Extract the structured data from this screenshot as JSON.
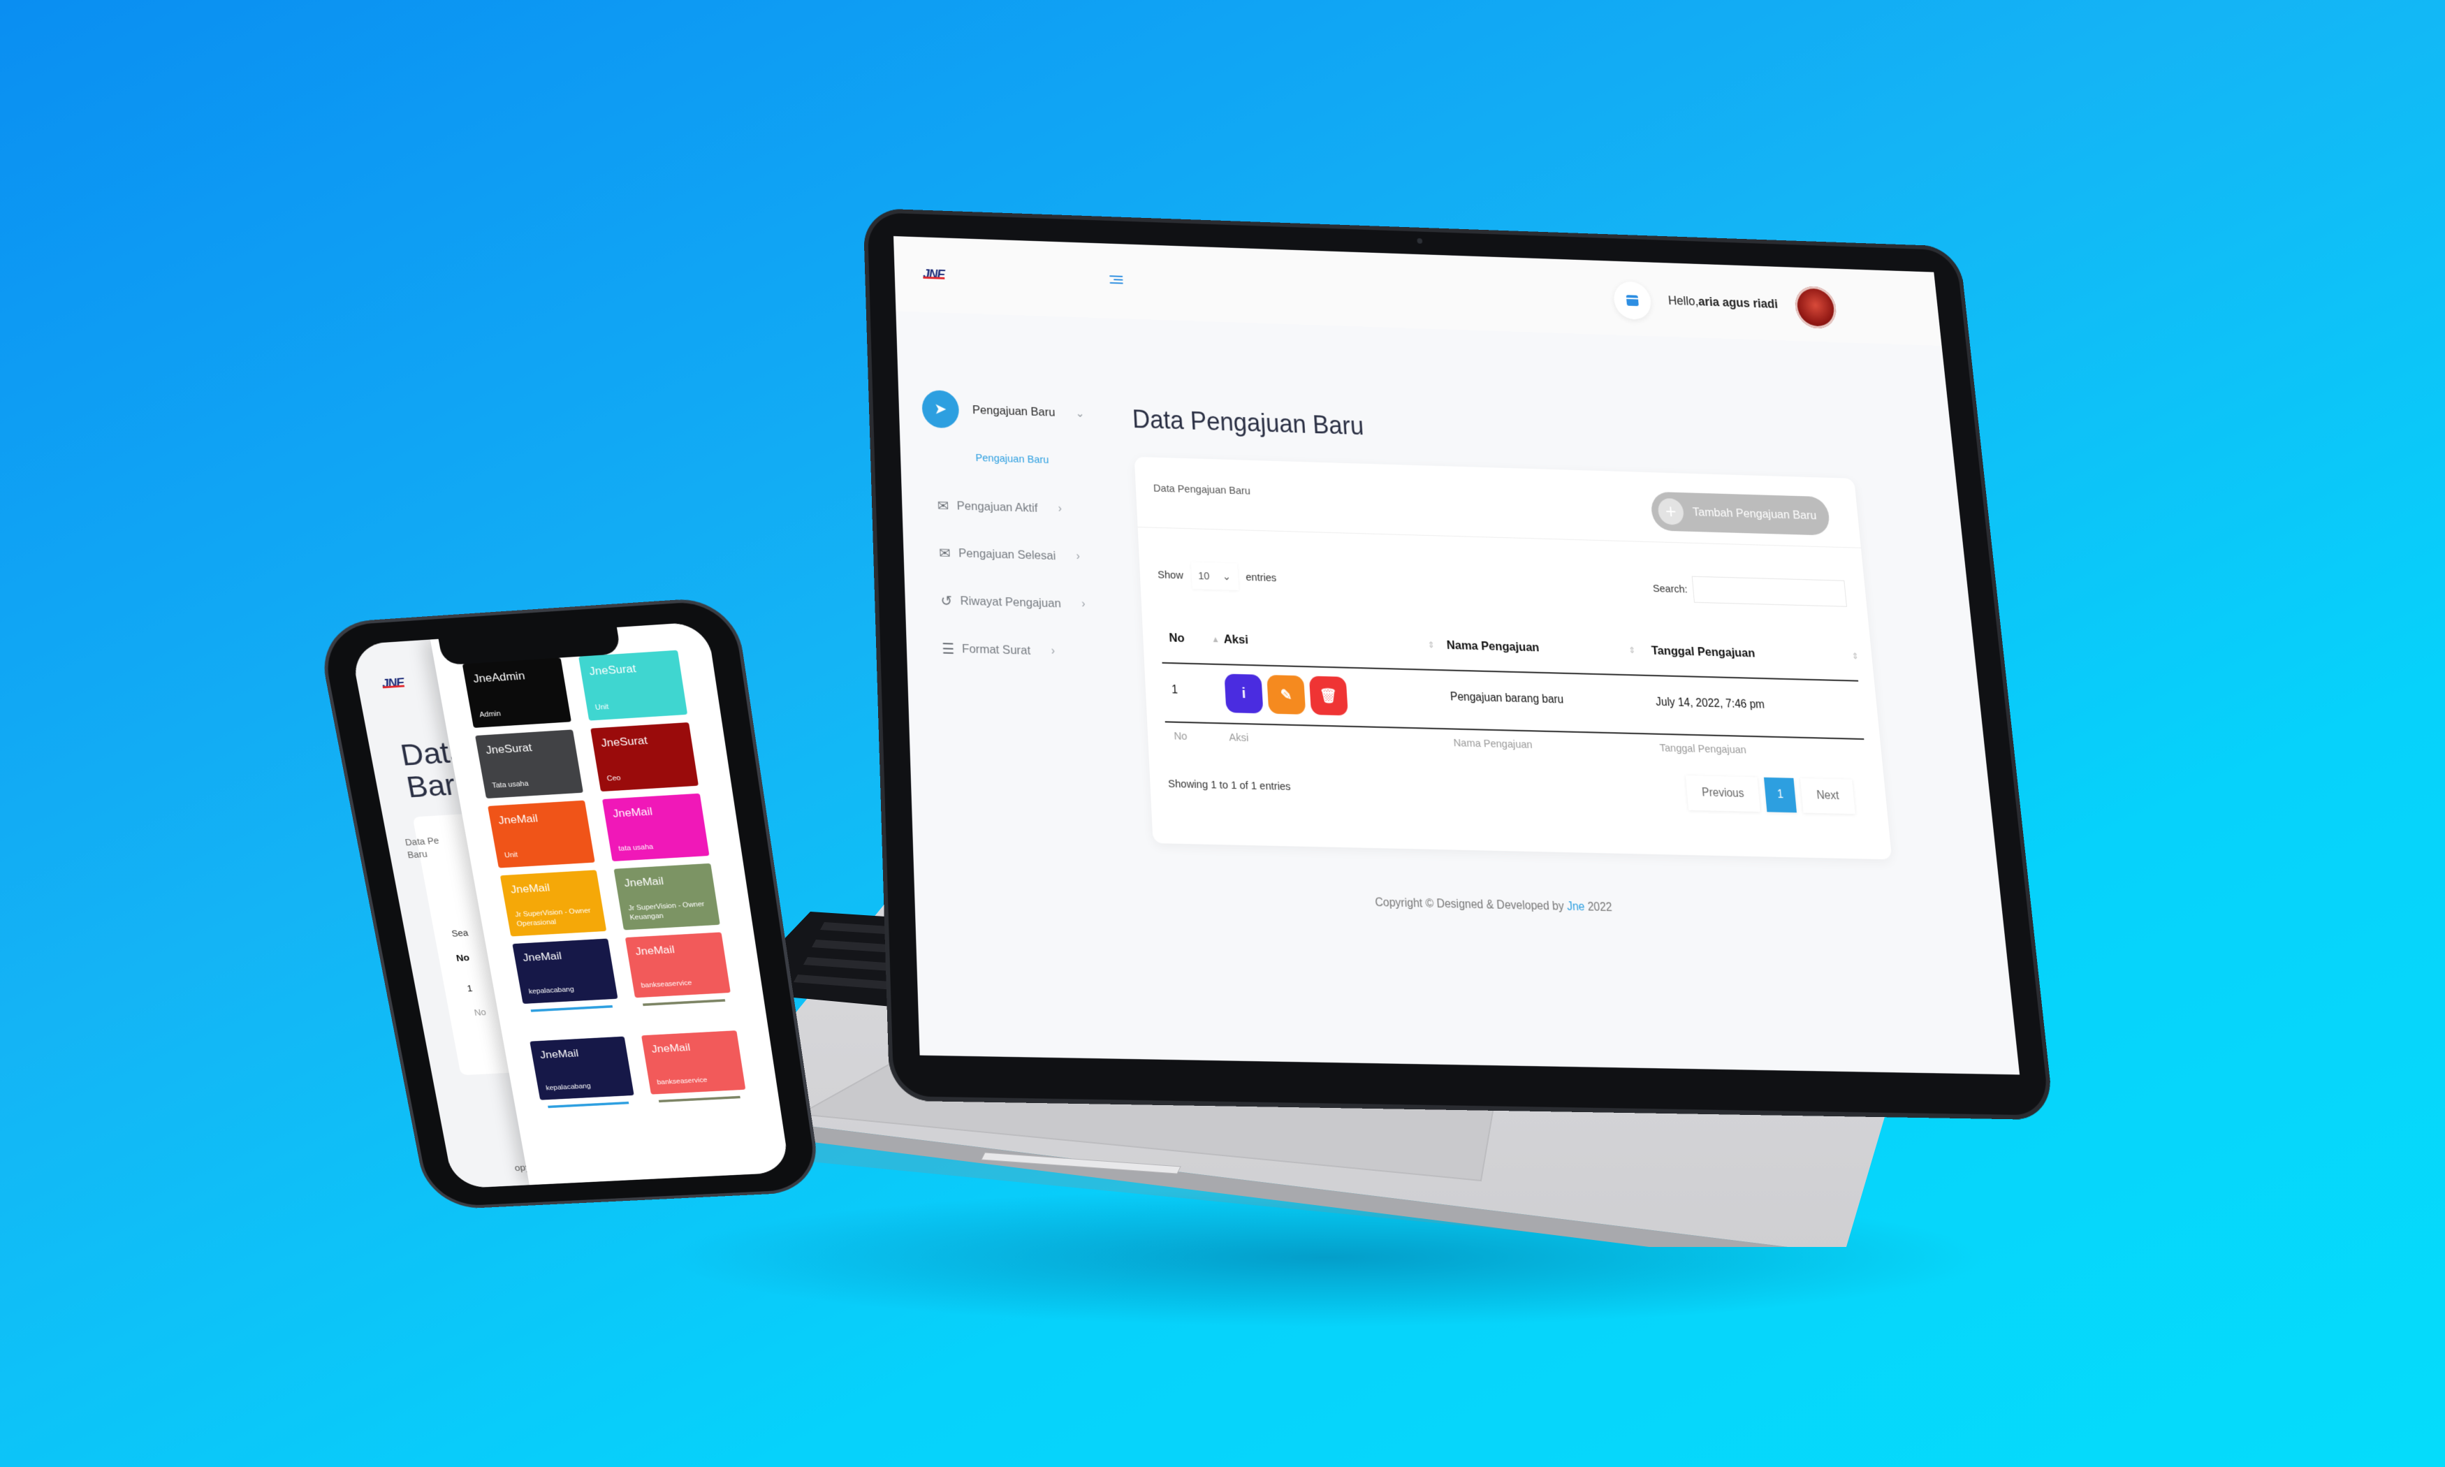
{
  "laptop": {
    "header": {
      "logo": "JNE",
      "greeting_prefix": "Hello,",
      "user_name": "aria agus riadi"
    },
    "sidebar": {
      "active_label": "Pengajuan Baru",
      "sub_label": "Pengajuan Baru",
      "items": [
        {
          "label": "Pengajuan Aktif",
          "icon": "mail-check-icon"
        },
        {
          "label": "Pengajuan Selesai",
          "icon": "mail-open-icon"
        },
        {
          "label": "Riwayat Pengajuan",
          "icon": "history-icon"
        },
        {
          "label": "Format Surat",
          "icon": "indent-icon"
        }
      ]
    },
    "main": {
      "page_title": "Data Pengajuan Baru",
      "card_subtitle": "Data Pengajuan Baru",
      "add_button": "Tambah Pengajuan Baru",
      "show_label": "Show",
      "entries_value": "10",
      "entries_label": "entries",
      "search_label": "Search:",
      "columns": [
        "No",
        "Aksi",
        "Nama Pengajuan",
        "Tanggal Pengajuan"
      ],
      "rows": [
        {
          "no": "1",
          "nama": "Pengajuan barang baru",
          "tanggal": "July 14, 2022, 7:46 pm"
        }
      ],
      "showing": "Showing 1 to 1 of 1 entries",
      "pagination": {
        "previous": "Previous",
        "current": "1",
        "next": "Next"
      }
    },
    "footer": {
      "copyright_prefix": "Copyright © Designed & Developed by",
      "brand": "Jne",
      "year": "2022"
    }
  },
  "phone": {
    "logo": "JNE",
    "title_line1": "Data",
    "title_line2": "Baru",
    "card_sub_line1": "Data Pe",
    "card_sub_line2": "Baru",
    "search_partial": "Sea",
    "col_no": "No",
    "row_no": "1",
    "foot_no": "No",
    "copyright_partial": "opyrigh",
    "tiles": [
      {
        "name": "JneAdmin",
        "role": "Admin",
        "color": "#0b0b0b"
      },
      {
        "name": "JneSurat",
        "role": "Unit",
        "color": "#3fd6d0"
      },
      {
        "name": "JneSurat",
        "role": "Tata usaha",
        "color": "#414245"
      },
      {
        "name": "JneSurat",
        "role": "Ceo",
        "color": "#9a0b0b"
      },
      {
        "name": "JneMail",
        "role": "Unit",
        "color": "#f05418"
      },
      {
        "name": "JneMail",
        "role": "tata usaha",
        "color": "#f018b8"
      },
      {
        "name": "JneMail",
        "role": "Jr SuperVision - Owner Operasional",
        "color": "#f5a808"
      },
      {
        "name": "JneMail",
        "role": "Jr SuperVision - Owner Keuangan",
        "color": "#7c9464"
      },
      {
        "name": "JneMail",
        "role": "kepalacabang",
        "color": "#161848"
      },
      {
        "name": "JneMail",
        "role": "bankseaservice",
        "color": "#f25a5a"
      },
      {
        "name": "JneMail",
        "role": "kepalacabang",
        "color": "#161848"
      },
      {
        "name": "JneMail",
        "role": "bankseaservice",
        "color": "#f25a5a"
      }
    ]
  }
}
